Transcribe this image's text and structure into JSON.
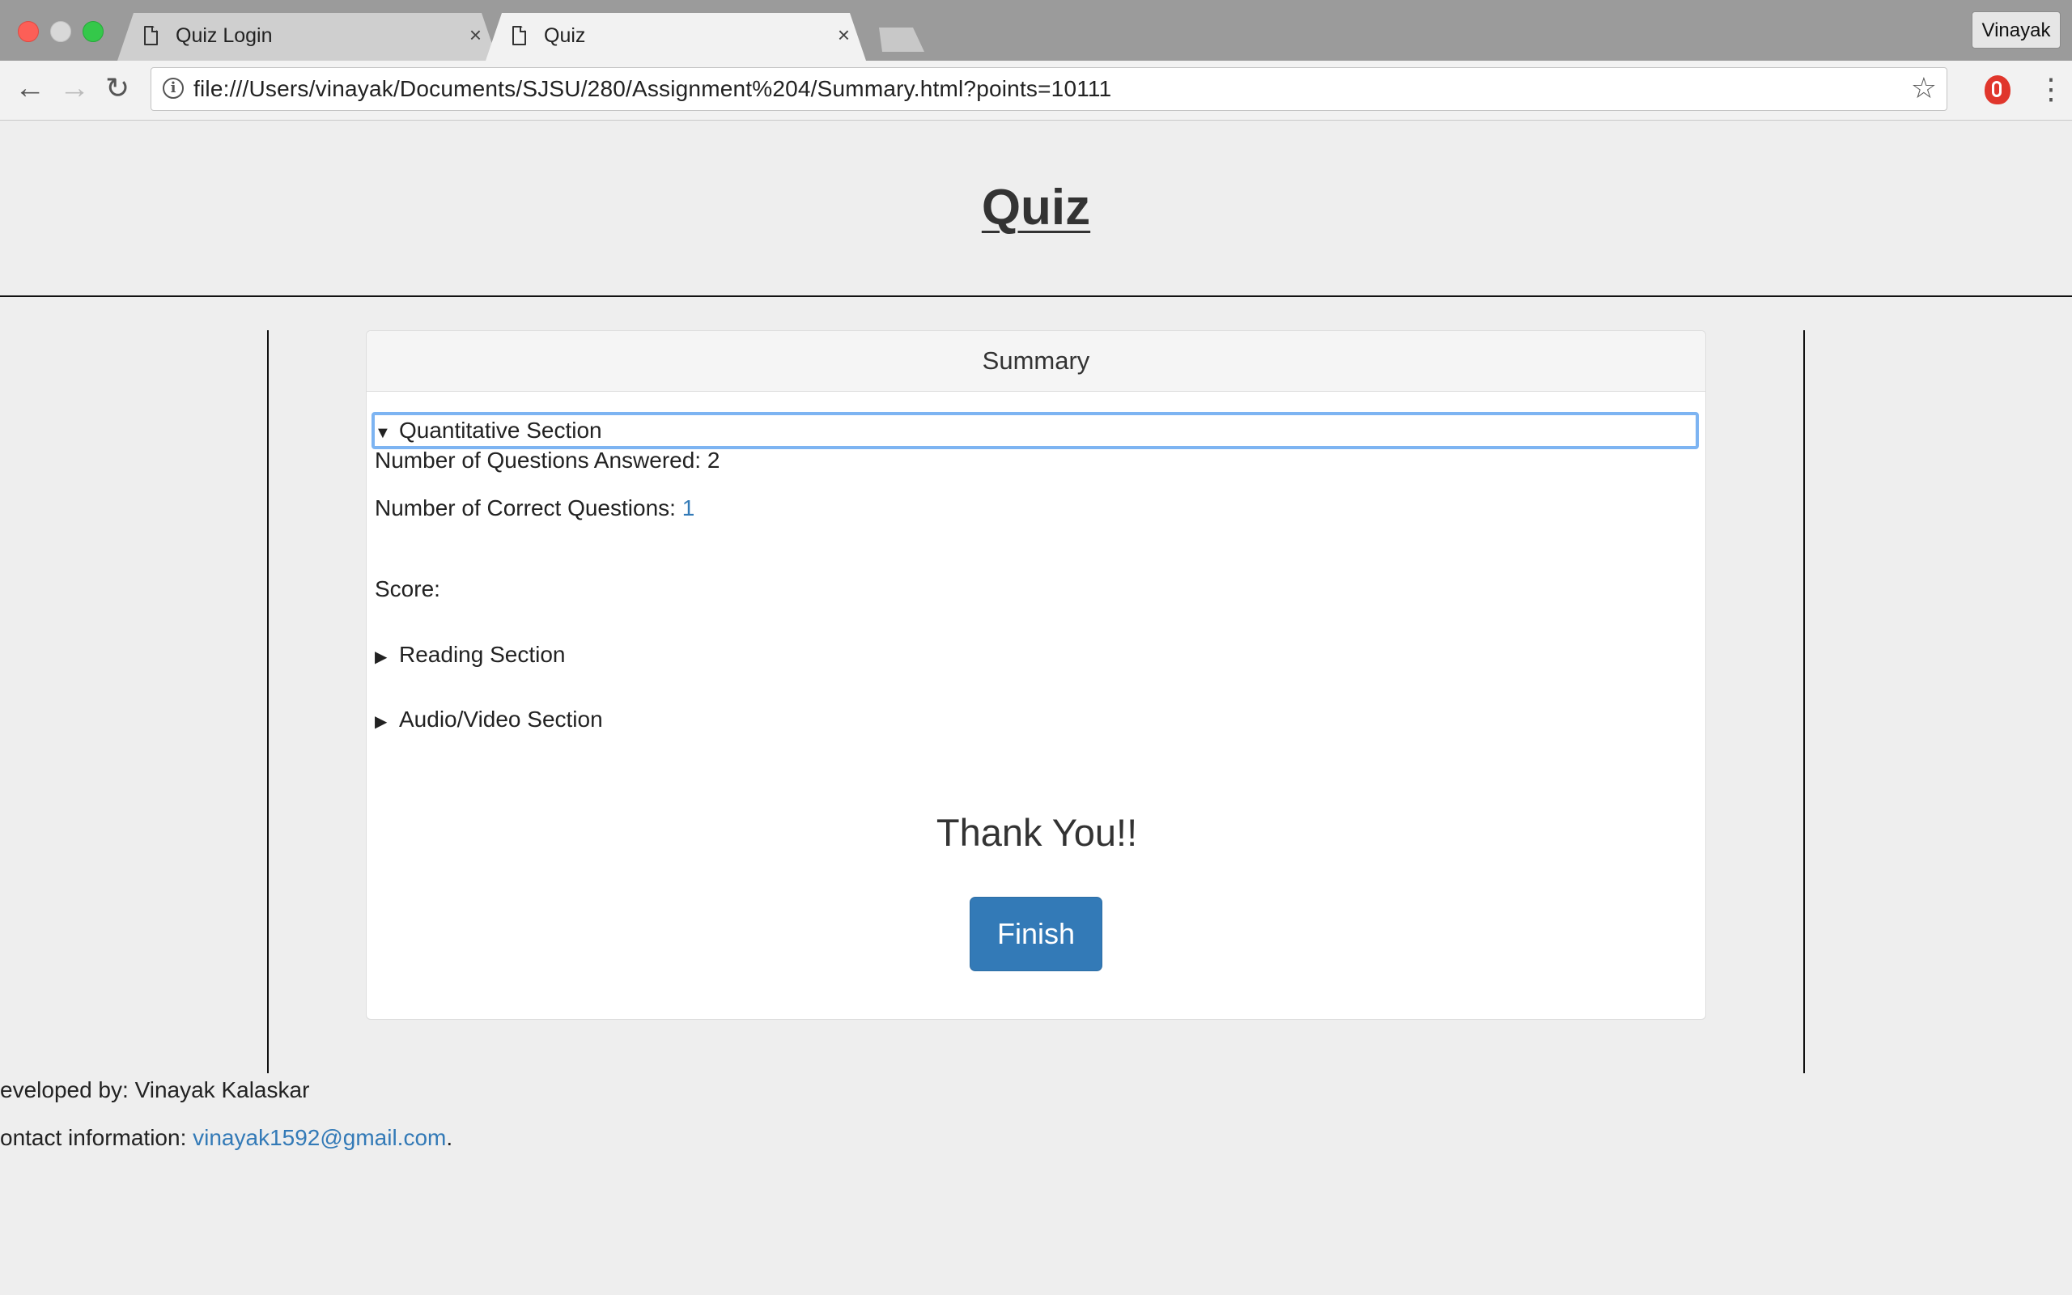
{
  "browser": {
    "tabs": [
      {
        "title": "Quiz Login",
        "close": "×",
        "active": false
      },
      {
        "title": "Quiz",
        "close": "×",
        "active": true
      }
    ],
    "profile_name": "Vinayak",
    "url": "file:///Users/vinayak/Documents/SJSU/280/Assignment%204/Summary.html?points=10111",
    "nav": {
      "back": "←",
      "forward": "→",
      "reload": "↻",
      "star": "☆",
      "menu": "⋮",
      "info": "i"
    }
  },
  "page": {
    "title": "Quiz",
    "summary": {
      "heading": "Summary",
      "sections": [
        {
          "label": "Quantitative Section",
          "expanded": true,
          "marker": "▼"
        },
        {
          "label": "Reading Section",
          "expanded": false,
          "marker": "▶"
        },
        {
          "label": "Audio/Video Section",
          "expanded": false,
          "marker": "▶"
        }
      ],
      "quantitative": {
        "answered_label": "Number of Questions Answered: ",
        "answered_value": "2",
        "correct_label": "Number of Correct Questions: ",
        "correct_value": "1",
        "score_label": "Score:"
      },
      "thank_you": "Thank You!!",
      "finish_label": "Finish"
    },
    "footer": {
      "developer": "eveloped by: Vinayak Kalaskar",
      "contact_label": "ontact information: ",
      "contact_email": "vinayak1592@gmail.com",
      "contact_suffix": "."
    }
  },
  "colors": {
    "link": "#337ab7",
    "button": "#337ab7",
    "focus_ring": "#7db4f2"
  }
}
